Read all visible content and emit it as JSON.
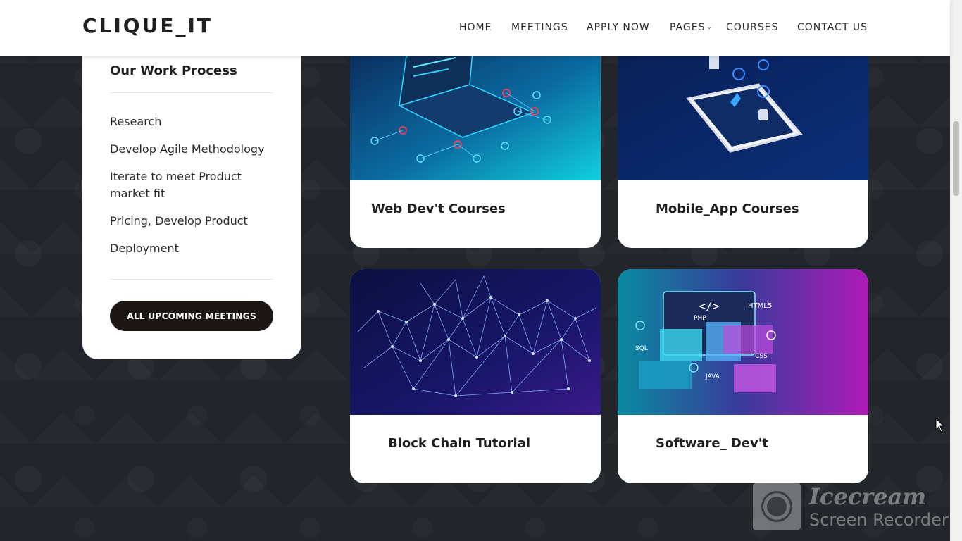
{
  "header": {
    "logo": "CLIQUE_IT",
    "nav": [
      {
        "label": "HOME"
      },
      {
        "label": "MEETINGS"
      },
      {
        "label": "APPLY NOW"
      },
      {
        "label": "PAGES"
      },
      {
        "label": "COURSES"
      },
      {
        "label": "CONTACT US"
      }
    ]
  },
  "sidebar": {
    "title": "Our Work Process",
    "items": [
      "Research",
      "Develop Agile Methodology",
      "Iterate to meet Product market fit",
      "Pricing, Develop Product",
      "Deployment"
    ],
    "button_label": "ALL UPCOMING MEETINGS"
  },
  "courses": [
    {
      "title": "Web Dev't Courses"
    },
    {
      "title": "Mobile_App Courses"
    },
    {
      "title": "Block Chain Tutorial"
    },
    {
      "title": "Software_ Dev't"
    }
  ],
  "watermark": {
    "title": "Icecream",
    "subtitle": "Screen Recorder"
  },
  "colors": {
    "background": "#22262b",
    "button": "#1c1614",
    "card": "#ffffff"
  }
}
